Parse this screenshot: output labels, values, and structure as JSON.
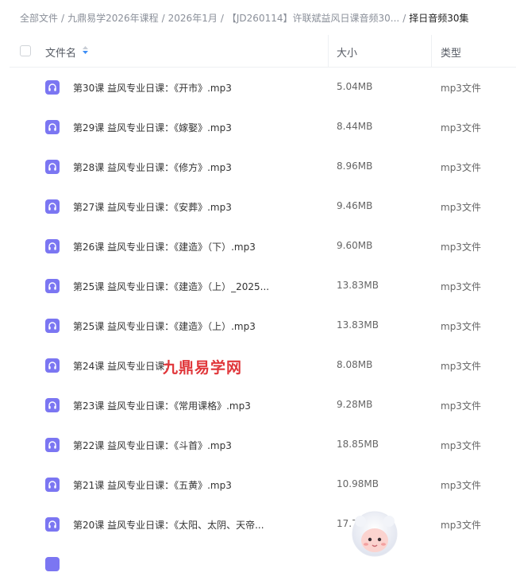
{
  "breadcrumb": {
    "items": [
      "全部文件",
      "九鼎易学2026年课程",
      "2026年1月",
      "【JD260114】许联斌益风日课音频30..."
    ],
    "current": "择日音频30集"
  },
  "table": {
    "columns": {
      "name": "文件名",
      "size": "大小",
      "type": "类型"
    },
    "rows": [
      {
        "name": "第30课 益风专业日课：《开市》.mp3",
        "size": "5.04MB",
        "type": "mp3文件"
      },
      {
        "name": "第29课 益风专业日课：《嫁娶》.mp3",
        "size": "8.44MB",
        "type": "mp3文件"
      },
      {
        "name": "第28课 益风专业日课：《修方》.mp3",
        "size": "8.96MB",
        "type": "mp3文件"
      },
      {
        "name": "第27课 益风专业日课：《安葬》.mp3",
        "size": "9.46MB",
        "type": "mp3文件"
      },
      {
        "name": "第26课 益风专业日课：《建造》（下）.mp3",
        "size": "9.60MB",
        "type": "mp3文件"
      },
      {
        "name": "第25课 益风专业日课：《建造》（上）_2025...",
        "size": "13.83MB",
        "type": "mp3文件"
      },
      {
        "name": "第25课 益风专业日课：《建造》（上）.mp3",
        "size": "13.83MB",
        "type": "mp3文件"
      },
      {
        "name": "第24课 益风专业日课：",
        "size": "8.08MB",
        "type": "mp3文件"
      },
      {
        "name": "第23课 益风专业日课：《常用课格》.mp3",
        "size": "9.28MB",
        "type": "mp3文件"
      },
      {
        "name": "第22课 益风专业日课：《斗首》.mp3",
        "size": "18.85MB",
        "type": "mp3文件"
      },
      {
        "name": "第21课 益风专业日课：《五黄》.mp3",
        "size": "10.98MB",
        "type": "mp3文件"
      },
      {
        "name": "第20课 益风专业日课：《太阳、太阴、天帝...",
        "size": "17.7",
        "type": "mp3文件"
      }
    ]
  },
  "watermark": "九鼎易学网",
  "colors": {
    "icon": "#7b76f2",
    "watermark": "#e0363a",
    "sort": "#3d8ef5"
  },
  "icons": {
    "file": "headphones-icon",
    "sort": "sort-icon"
  }
}
